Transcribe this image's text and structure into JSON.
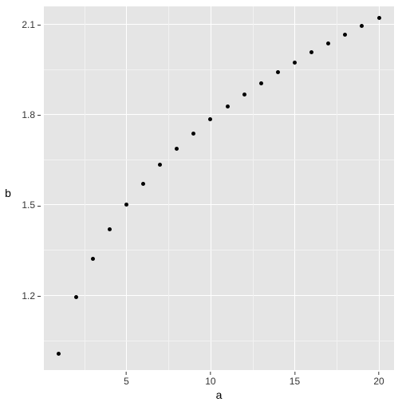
{
  "chart_data": {
    "type": "scatter",
    "title": "",
    "xlabel": "a",
    "ylabel": "b",
    "xlim": [
      0.1,
      20.9
    ],
    "ylim": [
      0.953,
      2.16
    ],
    "x_ticks": [
      5,
      10,
      15,
      20
    ],
    "y_ticks": [
      1.2,
      1.5,
      1.8,
      2.1
    ],
    "x": [
      1,
      2,
      3,
      4,
      5,
      6,
      7,
      8,
      9,
      10,
      11,
      12,
      13,
      14,
      15,
      16,
      17,
      18,
      19,
      20
    ],
    "y": [
      1.0,
      1.189,
      1.316,
      1.414,
      1.495,
      1.565,
      1.627,
      1.682,
      1.732,
      1.778,
      1.821,
      1.861,
      1.899,
      1.934,
      1.968,
      2.0,
      2.031,
      2.06,
      2.088,
      2.115
    ]
  }
}
